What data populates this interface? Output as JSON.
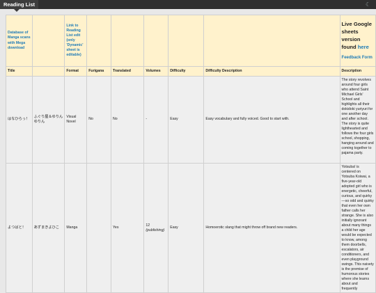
{
  "app": {
    "tab_title": "Reading List"
  },
  "header": {
    "database_link": "Database of Manga scans with Mega download",
    "reading_list_link": "Link to Reading List edit (only 'Dynamic' sheet is editable)",
    "live_sheets_text": "Live Google sheets version found",
    "live_sheets_link": "here",
    "feedback_link": "Feedback Form"
  },
  "columns": [
    "Title",
    "",
    "Format",
    "Furigana",
    "Translated",
    "Volumes",
    "Difficulty",
    "Difficulty Description",
    "Description"
  ],
  "rows": [
    {
      "title": "はなひらっ！",
      "author": "ふぐり屋＆ゆりん ゆりん",
      "format": "Visual Novel",
      "furigana": "No",
      "translated": "No",
      "volumes": "-",
      "volumes_note": "",
      "difficulty": "Easy",
      "difficulty_description": "Easy vocabulary and fully voiced. Good to start with.",
      "description": "The story revolves around four girls who attend Saint Michael Girls' School and highlights all their dokidoki yuriyuri for one another day and after school. The story is quite lighthearted and follows the four girls school, shopping, hanging around and coming together to pajama party."
    },
    {
      "title": "よつばと！",
      "author": "あずまきよひこ",
      "format": "Manga",
      "furigana": "",
      "translated": "Yes",
      "volumes": "12",
      "volumes_note": "(publishing)",
      "difficulty": "Easy",
      "difficulty_description": "Homoerotic slang that might throw off brand new readers.",
      "description": "Yotsubaǃ is centered on Yotsuba Koiwai, a five-year-old adopted girl who is energetic, cheerful, curious, and quirky—so odd and quirky that even her own father calls her strange. She is also initially ignorant about many things a child her age would be expected to know, among them doorbells, escalators, air conditioners, and even playground swings. This naivety is the premise of humorous stories where she learns about and frequently"
    }
  ]
}
